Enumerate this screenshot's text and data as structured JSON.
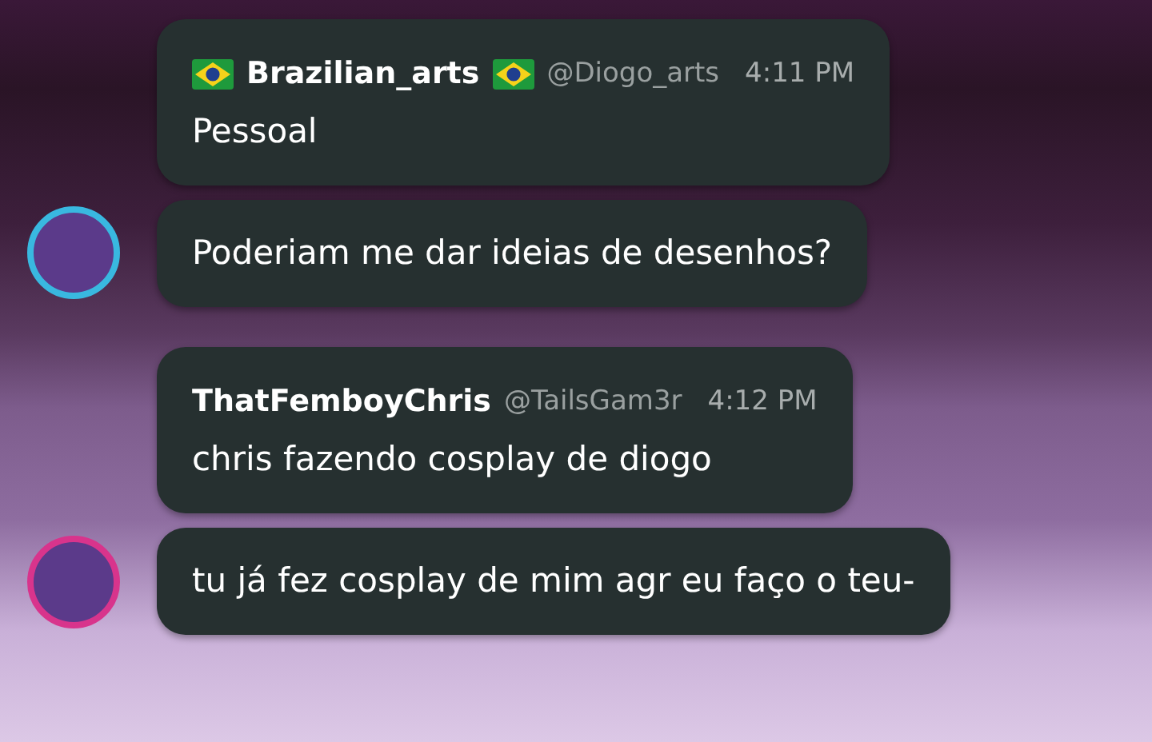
{
  "groups": [
    {
      "author": "Brazilian_arts",
      "name_flags": true,
      "handle": "@Diogo_arts",
      "time": "4:11 PM",
      "color": "#39b8e0",
      "messages": [
        "Pessoal",
        "Poderiam me dar ideias de desenhos?"
      ]
    },
    {
      "author": "ThatFemboyChris",
      "name_flags": false,
      "handle": "@TailsGam3r",
      "time": "4:12 PM",
      "color": "#d8348c",
      "messages": [
        "chris fazendo cosplay de diogo",
        "tu já fez cosplay de mim agr eu faço o teu-"
      ]
    }
  ]
}
